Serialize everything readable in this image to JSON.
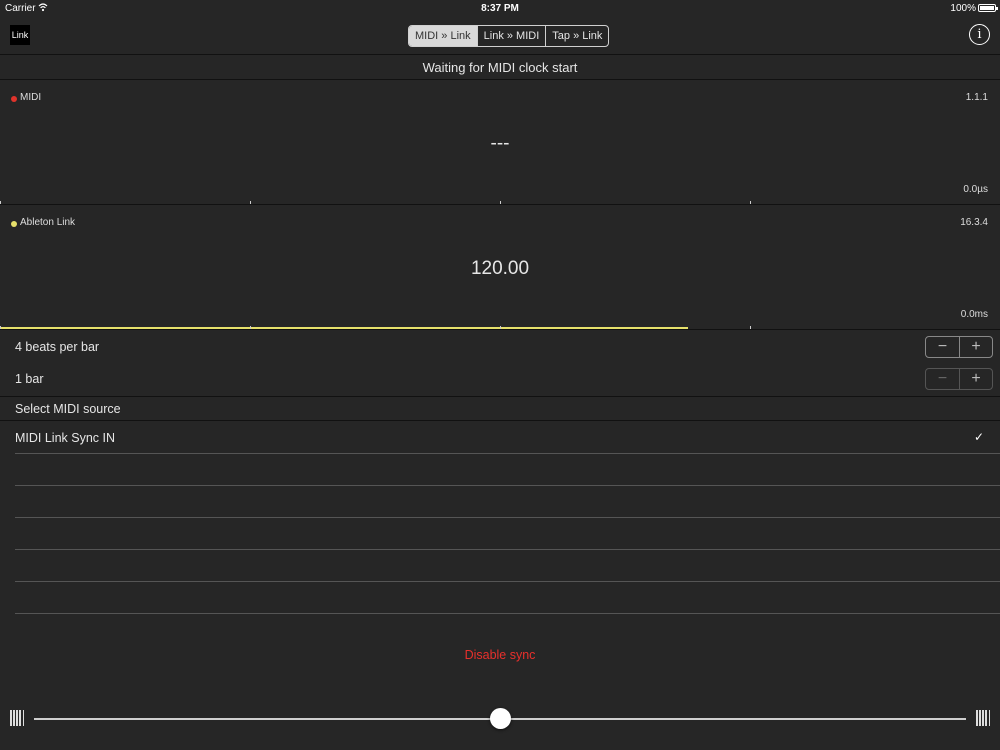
{
  "status_bar": {
    "carrier": "Carrier",
    "time": "8:37 PM",
    "battery": "100%"
  },
  "nav": {
    "logo": "Link",
    "modes": [
      "MIDI » Link",
      "Link » MIDI",
      "Tap » Link"
    ],
    "selected_mode": "MIDI » Link",
    "info_label": "i"
  },
  "status_message": "Waiting for MIDI clock start",
  "midi_panel": {
    "label": "MIDI",
    "indicator_color": "#e0332b",
    "position": "1.1.1",
    "tempo": "---",
    "latency": "0.0µs"
  },
  "link_panel": {
    "label": "Ableton Link",
    "indicator_color": "#e6e06b",
    "position": "16.3.4",
    "tempo": "120.00",
    "latency": "0.0ms",
    "bar_progress": 0.6875
  },
  "settings": {
    "beats_per_bar": "4 beats per bar",
    "bars": "1 bar",
    "minus": "−",
    "plus": "+"
  },
  "midi_source": {
    "header": "Select MIDI source",
    "items": [
      "MIDI Link Sync IN",
      "",
      "",
      "",
      "",
      ""
    ],
    "selected": "MIDI Link Sync IN",
    "check": "✓"
  },
  "disable_sync": "Disable sync",
  "slider": {
    "value": 0.5
  }
}
